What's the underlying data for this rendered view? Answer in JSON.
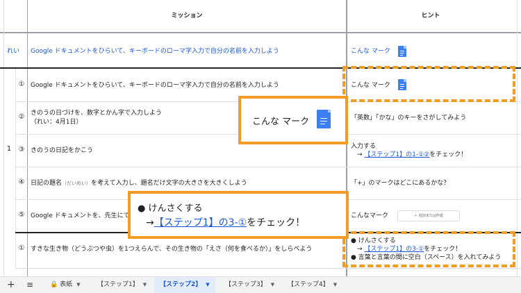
{
  "headers": {
    "mission": "ミッション",
    "hint": "ヒント"
  },
  "example": {
    "label": "れい",
    "mission": "Google ドキュメントをひらいて、キーボードのローマ字入力で自分の名前を入力しよう",
    "hint": "こんな マーク"
  },
  "row_group": "1",
  "rows": [
    {
      "num": "①",
      "mission": "Google ドキュメントをひらいて、キーボードのローマ字入力で自分の名前を入力しよう",
      "hint": "こんな マーク"
    },
    {
      "num": "②",
      "mission_l1": "きのうの日づけを、数字とかん字で入力しよう",
      "mission_l2": "（れい：4月1日）",
      "hint": "「英数」「かな」のキーをさがしてみよう"
    },
    {
      "num": "③",
      "mission": "きのうの日記をかこう",
      "hint_l1": "入力する",
      "hint_arrow": "→ ",
      "hint_link": "【ステップ1】の1-①②",
      "hint_tail": "をチェック！"
    },
    {
      "num": "④",
      "mission_a": "日記の題名",
      "mission_ruby": "（だいめい）",
      "mission_b": "を考えて入力し、題名だけ文字の大きさを大きくしよう",
      "hint": "「+」のマークはどこにあるかな？"
    },
    {
      "num": "⑤",
      "mission": "Google ドキュメントを、先生にて",
      "hint": "こんなマーク",
      "hint_button": "＋ 追加または作成"
    },
    {
      "num": "①",
      "mission": "すきな生き物（どうぶつや虫）を1つえらんで、その生き物の「えさ（何を食べるか）」をしらべよう",
      "hint_l1": "● けんさくする",
      "hint_arrow": "→ ",
      "hint_link": "【ステップ1】の3-①",
      "hint_tail": "をチェック！",
      "hint_l3": "● 言葉と言葉の間に空白（スペース）を入れてみよう"
    }
  ],
  "callout_mark": {
    "text": "こんな マーク"
  },
  "callout_search": {
    "line1": "● けんさくする",
    "arrow": "→",
    "link": "【ステップ1】の3-①",
    "tail": "をチェック！"
  },
  "tabs": [
    {
      "label": "表紙",
      "locked": true
    },
    {
      "label": "【ステップ1】"
    },
    {
      "label": "【ステップ2】",
      "active": true
    },
    {
      "label": "【ステップ3】"
    },
    {
      "label": "【ステップ4】"
    }
  ],
  "icons": {
    "add": "plus-icon",
    "menu": "sheet-list-icon",
    "lock": "lock-icon",
    "doc": "google-docs-icon"
  },
  "colors": {
    "accent": "#f39c25",
    "link": "#1a56d6",
    "doc": "#3c7ff2"
  }
}
